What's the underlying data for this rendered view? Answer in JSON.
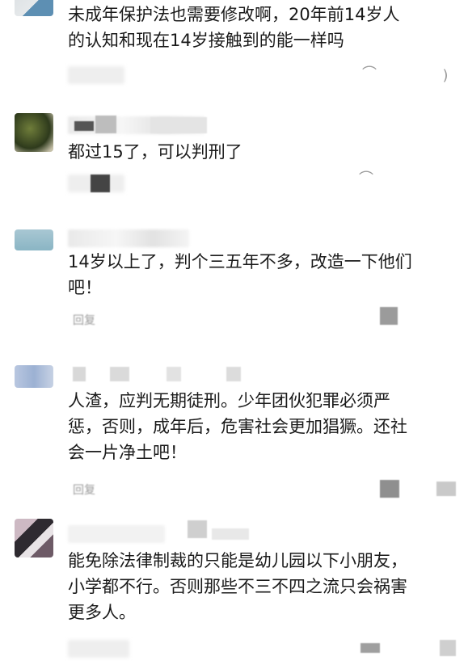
{
  "comments": [
    {
      "text": "未成年保护法也需要修改啊，20年前14岁人\n的认知和现在14岁接触到的能一样吗"
    },
    {
      "text": "都过15了，可以判刑了"
    },
    {
      "text": "14岁以上了，判个三五年不多，改造一下他们\n吧！",
      "reply_label": "回复"
    },
    {
      "text": "人渣，应判无期徒刑。少年团伙犯罪必须严\n惩，否则，成年后，危害社会更加猖獗。还社\n会一片净土吧！",
      "reply_label": "回复"
    },
    {
      "text": "能免除法律制裁的只能是幼儿园以下小朋友，\n小学都不行。否则那些不三不四之流只会祸害\n更多人。"
    }
  ],
  "icons": {
    "comment": "comment-icon",
    "like": "like-icon"
  },
  "colors": {
    "text": "#1a1a1a",
    "meta": "#999999"
  }
}
